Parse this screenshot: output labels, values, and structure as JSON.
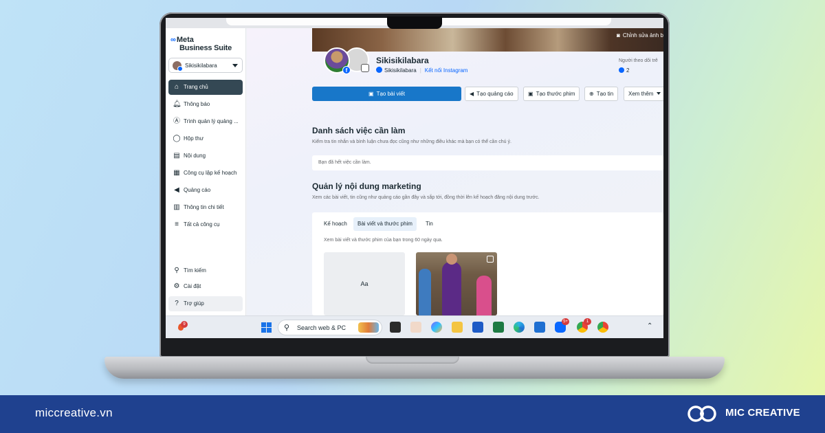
{
  "sidebar": {
    "logo_meta": "Meta",
    "logo_product": "Business Suite",
    "account_name": "Sikisikilabara",
    "items": [
      {
        "label": "Trang chủ",
        "icon": "home-icon"
      },
      {
        "label": "Thông báo",
        "icon": "bell-icon"
      },
      {
        "label": "Trình quản lý quảng ...",
        "icon": "ads-manager-icon"
      },
      {
        "label": "Hộp thư",
        "icon": "inbox-icon"
      },
      {
        "label": "Nội dung",
        "icon": "content-icon"
      },
      {
        "label": "Công cụ lập kế hoạch",
        "icon": "calendar-icon"
      },
      {
        "label": "Quảng cáo",
        "icon": "megaphone-icon"
      },
      {
        "label": "Thông tin chi tiết",
        "icon": "insights-icon"
      },
      {
        "label": "Tất cả công cụ",
        "icon": "menu-icon"
      }
    ],
    "bottom_items": [
      {
        "label": "Tìm kiếm",
        "icon": "search-icon"
      },
      {
        "label": "Cài đặt",
        "icon": "gear-icon"
      },
      {
        "label": "Trợ giúp",
        "icon": "help-icon"
      }
    ]
  },
  "profile": {
    "page_name": "Sikisikilabara",
    "fb_account": "Sikisikilabara",
    "connect_instagram": "Kết nối Instagram",
    "cover_edit_label": "Chỉnh sửa ảnh b",
    "followers_label": "Người theo dõi trê",
    "followers_count": "2"
  },
  "actions": {
    "create_post": "Tạo bài viết",
    "create_ad": "Tạo quảng cáo",
    "create_reel": "Tạo thước phim",
    "create_story": "Tạo tin",
    "more": "Xem thêm"
  },
  "todo": {
    "title": "Danh sách việc cần làm",
    "description": "Kiểm tra tin nhắn và bình luận chưa đọc cũng như những điều khác mà bạn có thể cần chú ý.",
    "empty_text": "Bạn đã hết việc cần làm."
  },
  "marketing": {
    "title": "Quản lý nội dung marketing",
    "description": "Xem các bài viết, tin cũng như quảng cáo gần đây và sắp tới, đồng thời lên kế hoạch đăng nội dung trước.",
    "tabs": [
      "Kế hoạch",
      "Bài viết và thước phim",
      "Tin"
    ],
    "active_tab": "Bài viết và thước phim",
    "card_description": "Xem bài viết và thước phim của bạn trong 60 ngày qua.",
    "text_tile": "Aa"
  },
  "taskbar": {
    "weather_badge": "9",
    "search_placeholder": "Search web & PC",
    "zalo_badge": "5+",
    "chrome_badge": "1"
  },
  "footer": {
    "site": "miccreative.vn",
    "brand": "MIC CREATIVE"
  },
  "colors": {
    "primary_button": "#1877c9",
    "active_nav": "#344854",
    "footer_band": "#1f418f",
    "meta_blue": "#0866ff"
  }
}
